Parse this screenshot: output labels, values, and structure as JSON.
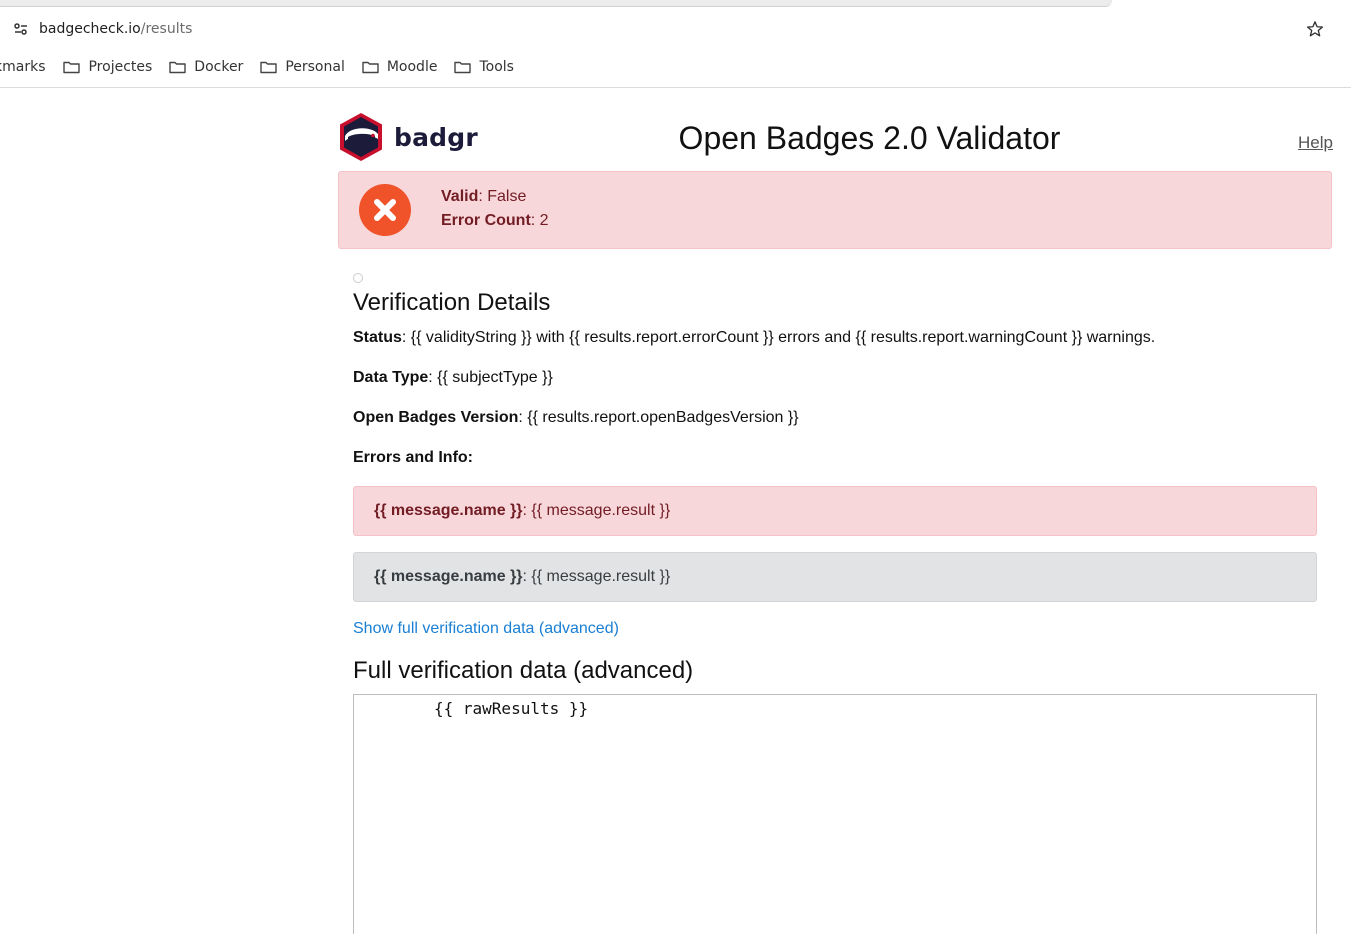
{
  "browser": {
    "url_host": "badgecheck.io",
    "url_path": "/results",
    "bookmarks": [
      {
        "label": "kmarks"
      },
      {
        "label": "Projectes"
      },
      {
        "label": "Docker"
      },
      {
        "label": "Personal"
      },
      {
        "label": "Moodle"
      },
      {
        "label": "Tools"
      }
    ]
  },
  "header": {
    "logo_text": "badgr",
    "title": "Open Badges 2.0 Validator",
    "help_label": "Help"
  },
  "summary": {
    "valid_label": "Valid",
    "valid_value": ": False",
    "error_label": "Error Count",
    "error_value": ": 2"
  },
  "details": {
    "title": "Verification Details",
    "status_label": "Status",
    "status_value": ": {{ validityString }} with {{ results.report.errorCount }} errors and {{ results.report.warningCount }} warnings.",
    "datatype_label": "Data Type",
    "datatype_value": ": {{ subjectType }}",
    "version_label": "Open Badges Version",
    "version_value": ": {{ results.report.openBadgesVersion }}",
    "errors_label": "Errors and Info:",
    "messages": [
      {
        "name": "{{ message.name }}",
        "result": ": {{ message.result }}",
        "level": "danger"
      },
      {
        "name": "{{ message.name }}",
        "result": ": {{ message.result }}",
        "level": "secondary"
      }
    ],
    "toggle_link": "Show full verification data (advanced)"
  },
  "advanced": {
    "title": "Full verification data (advanced)",
    "raw": "{{ rawResults }}"
  },
  "colors": {
    "error_icon": "#f0522a",
    "danger_bg": "#f8d7da",
    "secondary_bg": "#e2e3e5",
    "link": "#1a7fd4"
  }
}
